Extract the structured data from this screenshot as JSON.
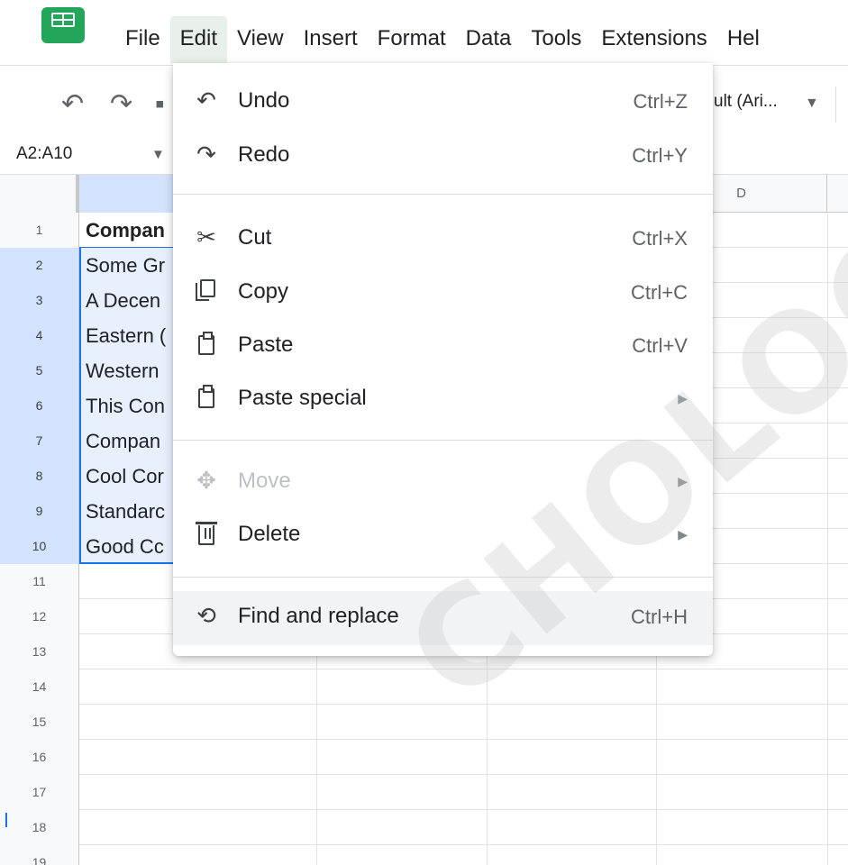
{
  "menubar": {
    "items": [
      "File",
      "Edit",
      "View",
      "Insert",
      "Format",
      "Data",
      "Tools",
      "Extensions",
      "Hel"
    ],
    "active": "Edit"
  },
  "toolbar": {
    "font_name": "ult (Ari..."
  },
  "namebox": {
    "value": "A2:A10"
  },
  "columns": {
    "d_label": "D"
  },
  "rows": [
    {
      "num": "1",
      "a": "Compan"
    },
    {
      "num": "2",
      "a": "Some Gr"
    },
    {
      "num": "3",
      "a": "A Decen"
    },
    {
      "num": "4",
      "a": "Eastern ("
    },
    {
      "num": "5",
      "a": "Western"
    },
    {
      "num": "6",
      "a": "This Con"
    },
    {
      "num": "7",
      "a": "Compan"
    },
    {
      "num": "8",
      "a": "Cool Cor"
    },
    {
      "num": "9",
      "a": "Standarc"
    },
    {
      "num": "10",
      "a": "Good Cc"
    },
    {
      "num": "11",
      "a": ""
    },
    {
      "num": "12",
      "a": ""
    },
    {
      "num": "13",
      "a": ""
    },
    {
      "num": "14",
      "a": ""
    },
    {
      "num": "15",
      "a": ""
    },
    {
      "num": "16",
      "a": ""
    },
    {
      "num": "17",
      "a": ""
    },
    {
      "num": "18",
      "a": ""
    },
    {
      "num": "19",
      "a": ""
    }
  ],
  "edit_menu": {
    "undo": {
      "label": "Undo",
      "shortcut": "Ctrl+Z"
    },
    "redo": {
      "label": "Redo",
      "shortcut": "Ctrl+Y"
    },
    "cut": {
      "label": "Cut",
      "shortcut": "Ctrl+X"
    },
    "copy": {
      "label": "Copy",
      "shortcut": "Ctrl+C"
    },
    "paste": {
      "label": "Paste",
      "shortcut": "Ctrl+V"
    },
    "paste_special": {
      "label": "Paste special"
    },
    "move": {
      "label": "Move"
    },
    "delete": {
      "label": "Delete"
    },
    "find_replace": {
      "label": "Find and replace",
      "shortcut": "Ctrl+H"
    }
  },
  "watermark": {
    "text": "CHOLOGY"
  },
  "colors": {
    "accent": "#1a73e8",
    "selection_fill": "#e8f0fe",
    "header_selected": "#d3e3fd",
    "logo_green": "#23a55a"
  }
}
